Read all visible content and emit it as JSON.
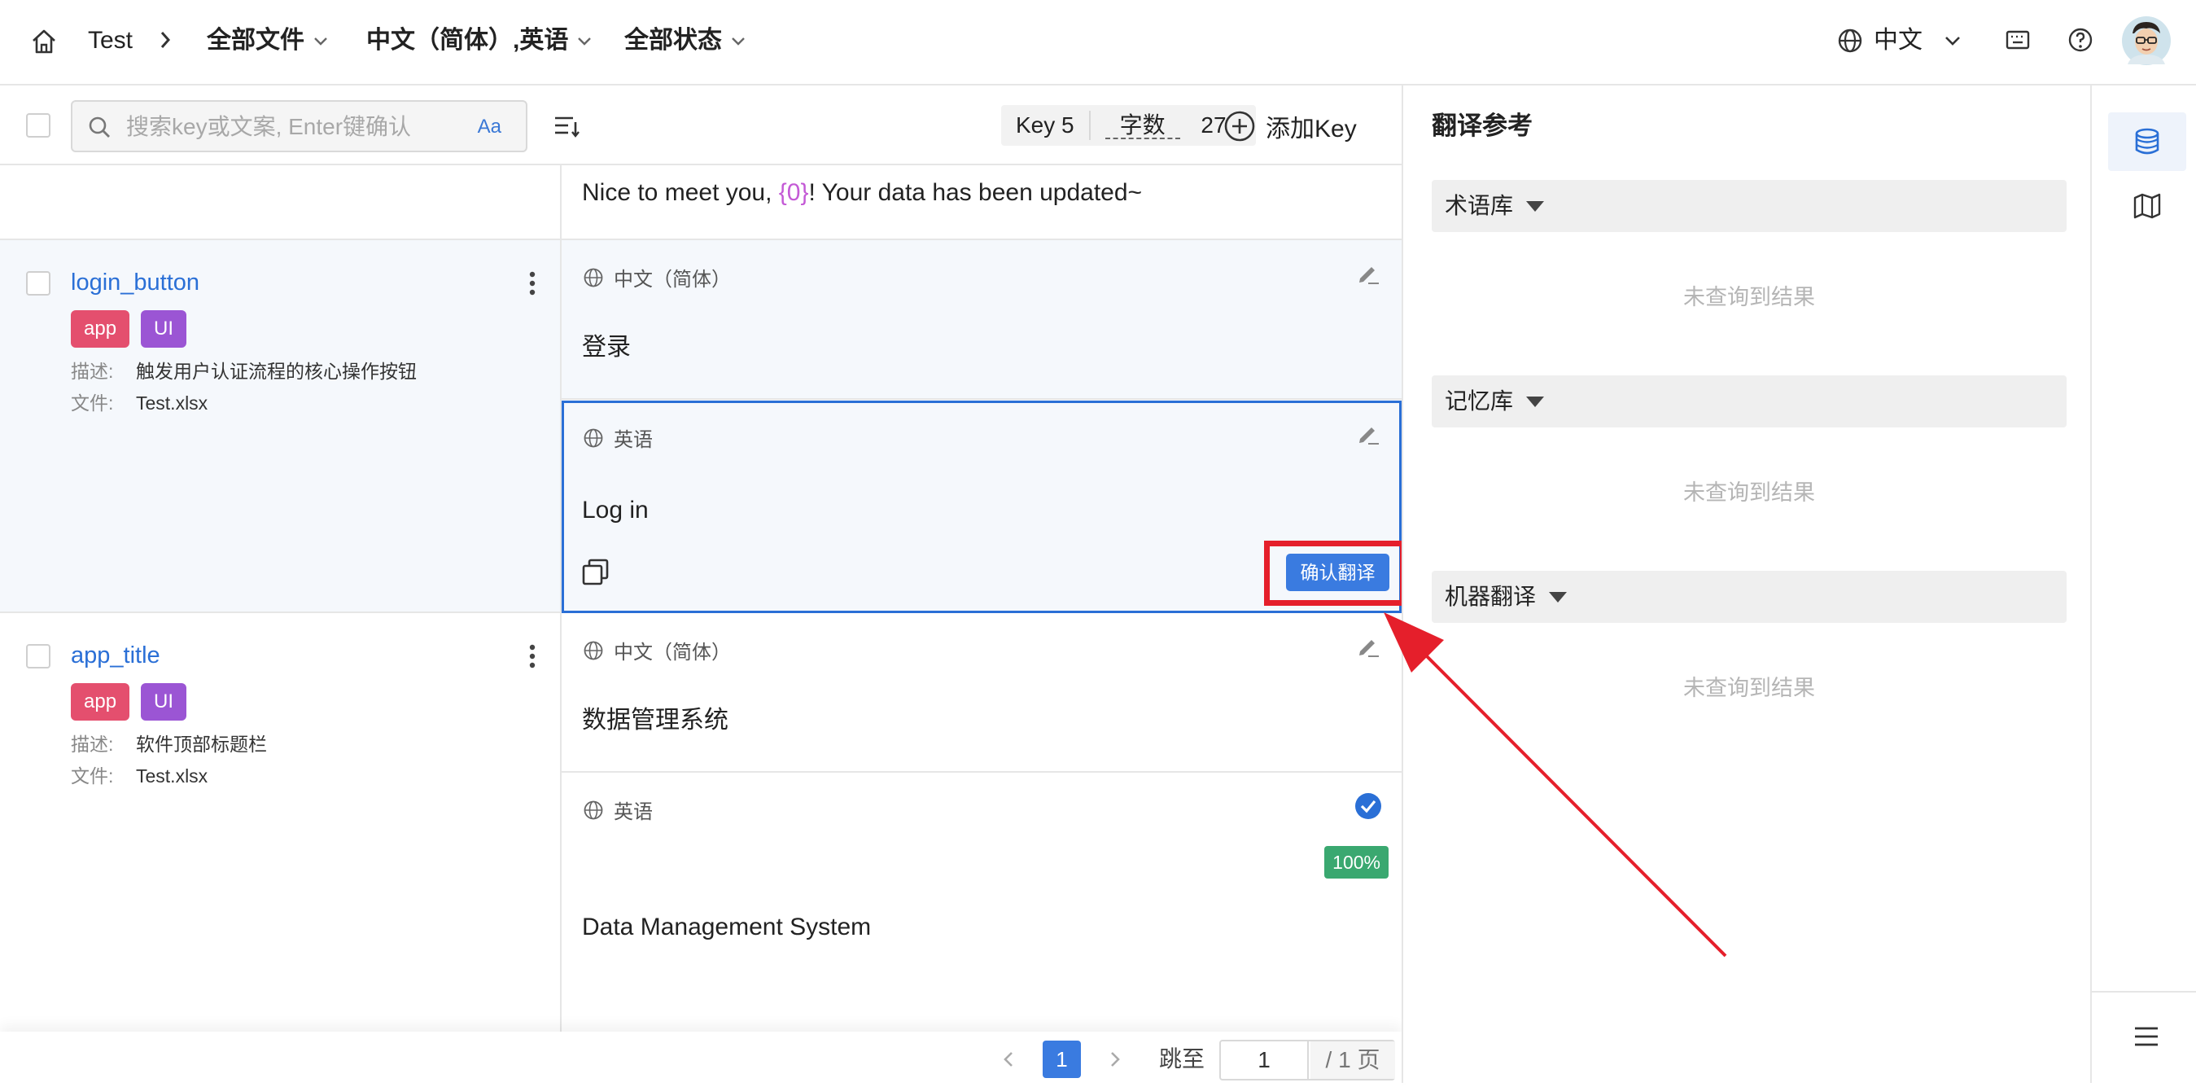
{
  "topbar": {
    "project": "Test",
    "files_filter": "全部文件",
    "lang_filter": "中文（简体）,英语",
    "status_filter": "全部状态",
    "ui_language": "中文"
  },
  "toolbar": {
    "search_placeholder": "搜索key或文案, Enter键确认",
    "case_toggle": "Aa",
    "key_count_label": "Key 5",
    "char_count_label": "字数",
    "char_count_value": "27",
    "add_key": "添加Key"
  },
  "partial_row": {
    "text_before": "Nice to meet you, ",
    "placeholder_token": "{0}",
    "text_after": "! Your data has been updated~"
  },
  "keys": [
    {
      "key": "login_button",
      "tags": [
        "app",
        "UI"
      ],
      "desc_label": "描述:",
      "desc": "触发用户认证流程的核心操作按钮",
      "file_label": "文件:",
      "file": "Test.xlsx",
      "translations": [
        {
          "lang": "中文（简体）",
          "text": "登录"
        },
        {
          "lang": "英语",
          "text": "Log in",
          "action": "确认翻译"
        }
      ]
    },
    {
      "key": "app_title",
      "tags": [
        "app",
        "UI"
      ],
      "desc_label": "描述:",
      "desc": "软件顶部标题栏",
      "file_label": "文件:",
      "file": "Test.xlsx",
      "translations": [
        {
          "lang": "中文（简体）",
          "text": "数据管理系统"
        },
        {
          "lang": "英语",
          "text": "Data Management System",
          "match": "100%"
        }
      ]
    }
  ],
  "pagination": {
    "current": "1",
    "jump_label": "跳至",
    "jump_value": "1",
    "total": "/ 1 页"
  },
  "reference": {
    "title": "翻译参考",
    "sections": [
      {
        "name": "术语库",
        "empty": "未查询到结果"
      },
      {
        "name": "记忆库",
        "empty": "未查询到结果"
      },
      {
        "name": "机器翻译",
        "empty": "未查询到结果"
      }
    ]
  },
  "colors": {
    "accent": "#2a6fd6",
    "tag_app": "#e44f6e",
    "tag_ui": "#9b55d4",
    "match_green": "#3aa870",
    "placeholder_purple": "#c45ad6",
    "annotation_red": "#e51f2b"
  }
}
